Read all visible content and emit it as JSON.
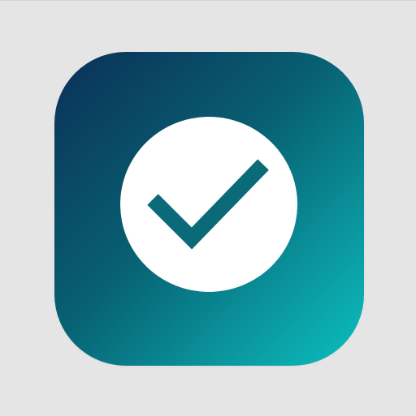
{
  "icon": {
    "name": "checkmark-app-icon",
    "colors": {
      "background": "#e5e5e5",
      "gradient_start": "#0b2f57",
      "gradient_mid": "#086072",
      "gradient_end": "#0bbfbf",
      "circle": "#ffffff",
      "checkmark": "#0a6a78"
    }
  }
}
